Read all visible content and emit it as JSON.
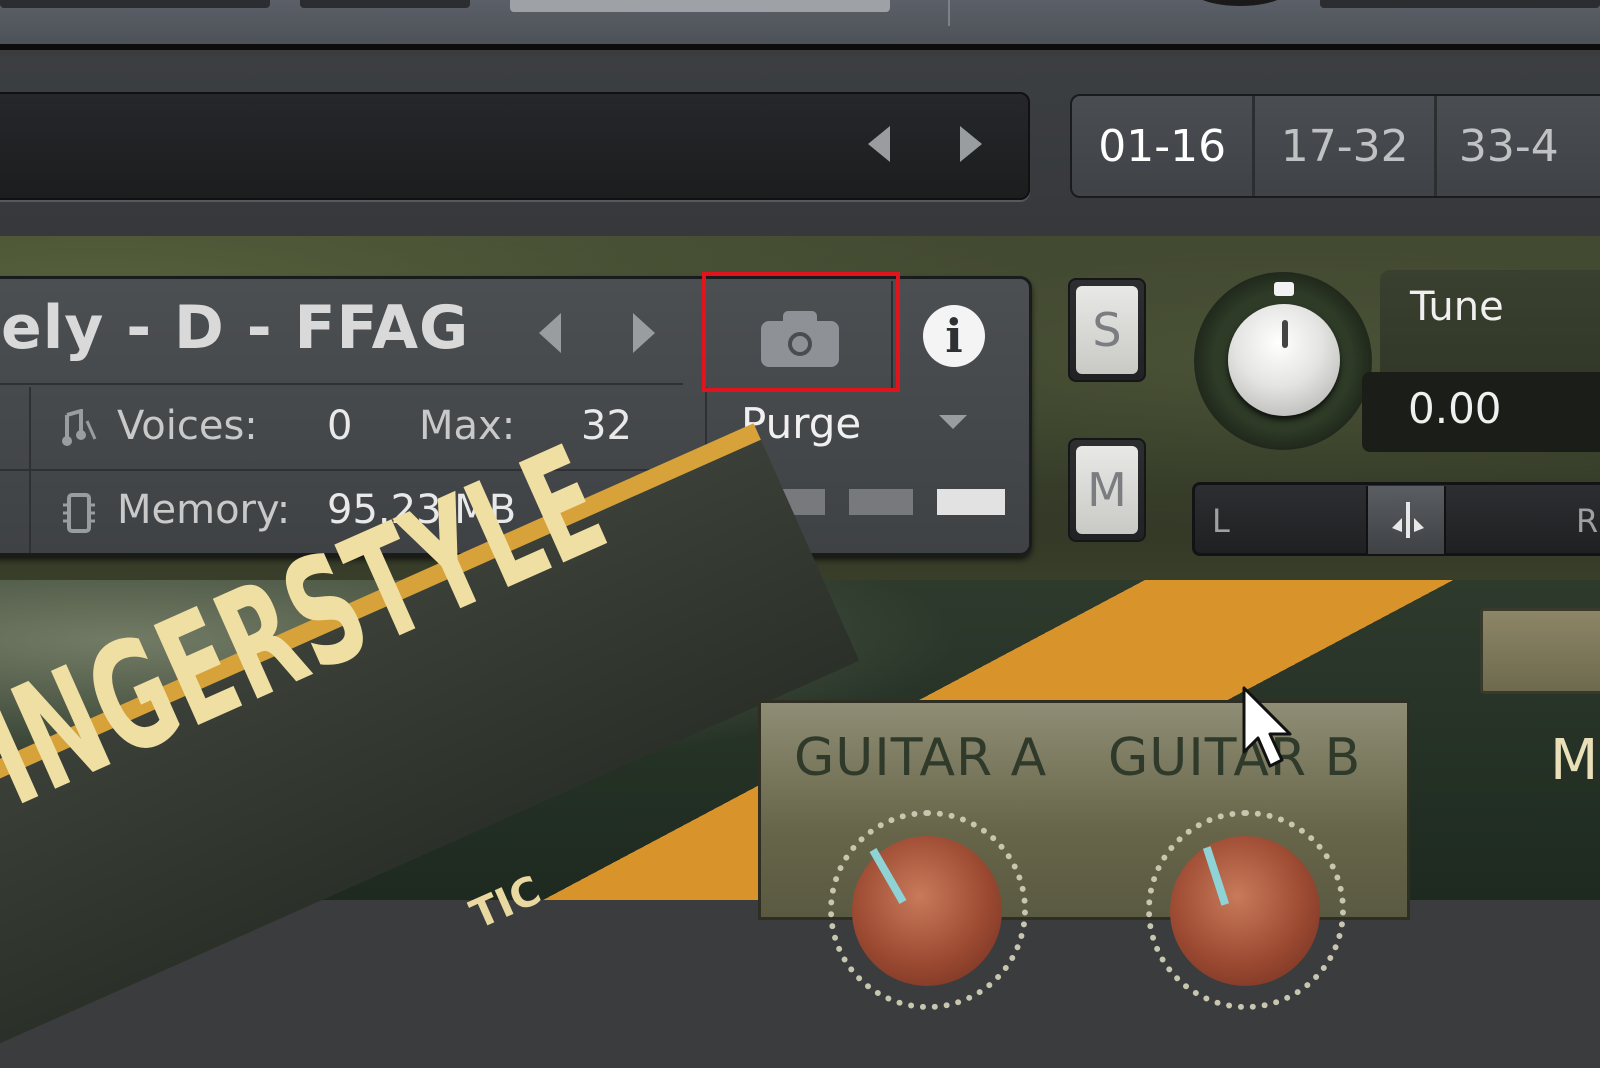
{
  "nav": {
    "pages": [
      {
        "label": "01-16",
        "active": true
      },
      {
        "label": "17-32",
        "active": false
      },
      {
        "label": "33-4",
        "active": false
      }
    ]
  },
  "instrument": {
    "name": "ely - D - FFAG",
    "voices_label": "Voices:",
    "voices_value": "0",
    "max_label": "Max:",
    "max_value": "32",
    "memory_label": "Memory:",
    "memory_value": "95.23 MB",
    "purge_label": "Purge",
    "info_glyph": "i",
    "solo_label": "S",
    "mute_label": "M",
    "tune_label": "Tune",
    "tune_value": "0.00",
    "pan_left": "L",
    "pan_right": "R"
  },
  "gui": {
    "banner": "FINGERSTYLE",
    "subtitle": "TIC",
    "guitar_a": "GUITAR A",
    "guitar_b": "GUITAR B",
    "right_letter": "M"
  },
  "colors": {
    "highlight": "#e0141c",
    "accent_orange": "#d9932b"
  },
  "icons": [
    "camera-icon",
    "info-icon",
    "voices-icon",
    "memory-icon",
    "arrow-left-icon",
    "arrow-right-icon",
    "dropdown-arrow-icon"
  ]
}
